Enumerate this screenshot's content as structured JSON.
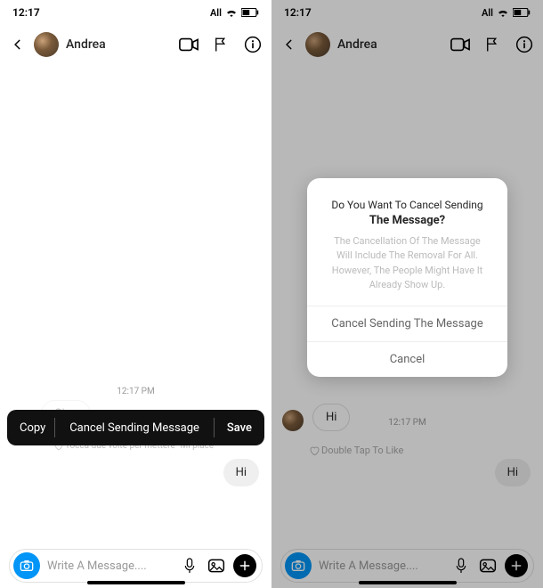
{
  "status": {
    "time": "12:17",
    "network": "All"
  },
  "left": {
    "contact_name": "Andrea",
    "timestamp": "12:17 PM",
    "incoming": "Ciao",
    "outgoing": "Hi",
    "tap_like": "Tocca due volte per mettere \"Mi piace\"",
    "context_menu": {
      "copy": "Copy",
      "cancel": "Cancel Sending Message",
      "save": "Save"
    },
    "composer_placeholder": "Write A Message...."
  },
  "right": {
    "contact_name": "Andrea",
    "timestamp": "12:17 PM",
    "incoming": "Hi",
    "outgoing": "Hi",
    "tap_like": "Double Tap To Like",
    "composer_placeholder": "Write A Message....",
    "modal": {
      "title_line1": "Do You Want To Cancel Sending",
      "title_line2": "The Message?",
      "body": "The Cancellation Of The Message Will Include The Removal For All. However, The People Might Have It Already Show Up.",
      "confirm": "Cancel Sending The Message",
      "cancel": "Cancel"
    }
  },
  "icons": {
    "back": "back-icon",
    "video": "video-call-icon",
    "flag": "flag-icon",
    "info": "info-icon",
    "wifi": "wifi-icon",
    "battery": "battery-icon",
    "mic": "microphone-icon",
    "gallery": "gallery-icon",
    "plus": "plus-icon",
    "camera": "camera-icon",
    "heart": "heart-icon"
  }
}
